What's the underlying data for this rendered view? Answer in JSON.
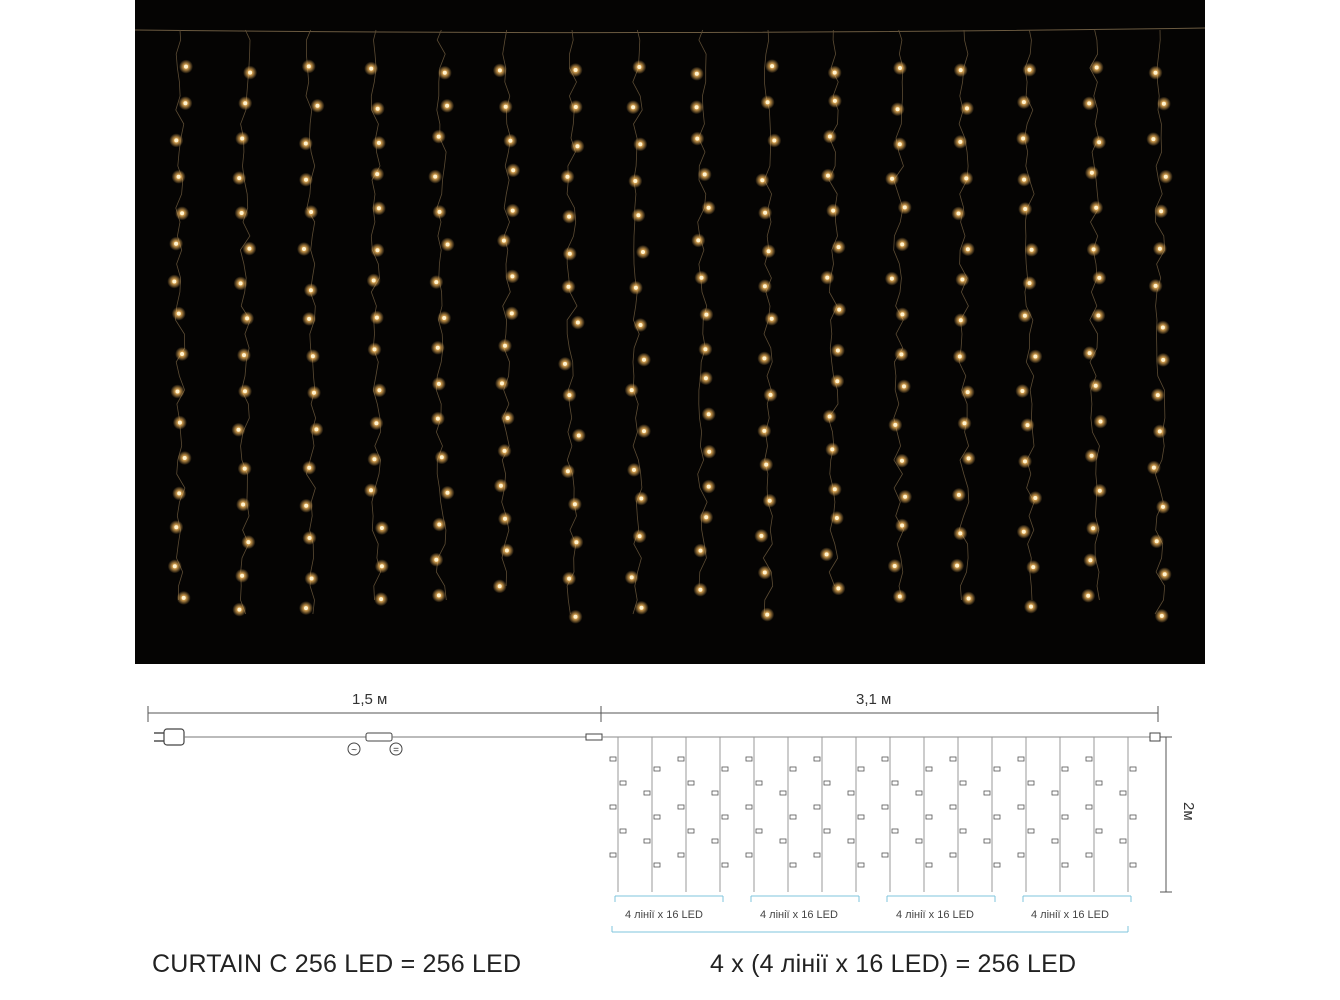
{
  "photo": {
    "subject": "warm-white LED curtain lights on black background",
    "led_color": "#ffc060",
    "background_color": "#050403"
  },
  "diagram": {
    "lead_length_label": "1,5 м",
    "curtain_width_label": "3,1 м",
    "curtain_height_label": "2м",
    "ac_symbol": "~",
    "dc_symbol": "=",
    "segment_label": "4 лінії x 16 LED",
    "segment_count": 4,
    "lines_per_segment": 4,
    "segment_line_color": "#7fc4dc"
  },
  "captions": {
    "left": "CURTAIN C 256 LED = 256 LED",
    "right": "4 x (4 лінії x 16 LED) = 256 LED"
  }
}
